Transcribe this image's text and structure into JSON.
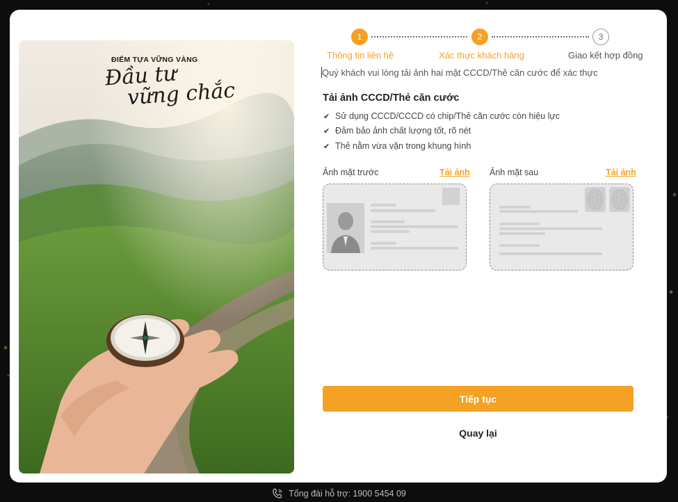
{
  "hero": {
    "tagline": "ĐIỂM TỰA VỮNG VÀNG",
    "script_line1": "Đầu tư",
    "script_line2": "vững chắc"
  },
  "steps": [
    {
      "number": "1",
      "label": "Thông tin liên hệ",
      "state": "done"
    },
    {
      "number": "2",
      "label": "Xác thực khách hàng",
      "state": "current"
    },
    {
      "number": "3",
      "label": "Giao kết hợp đồng",
      "state": "todo"
    }
  ],
  "instruction": "Quý khách vui lòng tải ảnh hai mặt CCCD/Thẻ căn cước để xác thực",
  "upload": {
    "title": "Tải ảnh CCCD/Thẻ căn cước",
    "rules": [
      "Sử dụng CCCD/CCCD có chip/Thẻ căn cước còn hiệu lực",
      "Đảm bảo ảnh chất lượng tốt, rõ nét",
      "Thẻ nằm vừa vặn trong khung hình"
    ],
    "front_label": "Ảnh mặt trước",
    "back_label": "Ảnh mặt sau",
    "upload_link": "Tải ảnh"
  },
  "buttons": {
    "continue": "Tiếp tục",
    "back": "Quay lại"
  },
  "footer": {
    "hotline": "Tổng đài hỗ trợ: 1900 5454 09"
  },
  "colors": {
    "accent": "#f4a124",
    "text": "#222222",
    "muted": "#555555"
  },
  "icons": [
    "check-icon",
    "phone-icon",
    "avatar-placeholder-icon",
    "fingerprint-icon"
  ]
}
